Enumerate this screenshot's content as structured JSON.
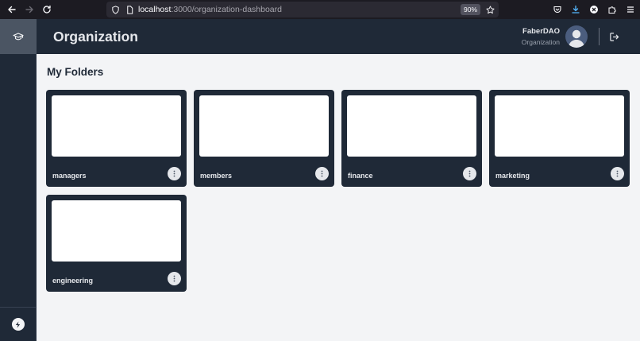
{
  "browser": {
    "url_host": "localhost",
    "url_path": ":3000/organization-dashboard",
    "zoom": "90%"
  },
  "header": {
    "title": "Organization",
    "user_name": "FaberDAO",
    "user_role": "Organization"
  },
  "main": {
    "section_title": "My Folders",
    "folders": [
      {
        "name": "managers"
      },
      {
        "name": "members"
      },
      {
        "name": "finance"
      },
      {
        "name": "marketing"
      },
      {
        "name": "engineering"
      }
    ]
  },
  "colors": {
    "sidebar": "#1f2937",
    "page_bg": "#f3f4f6",
    "card": "#1f2937"
  },
  "icons": {
    "sidebar_logo": "graduation-cap-icon",
    "sidebar_bottom": "lightning-bolt-icon",
    "logout": "logout-icon",
    "folder_menu": "kebab-menu-icon"
  }
}
